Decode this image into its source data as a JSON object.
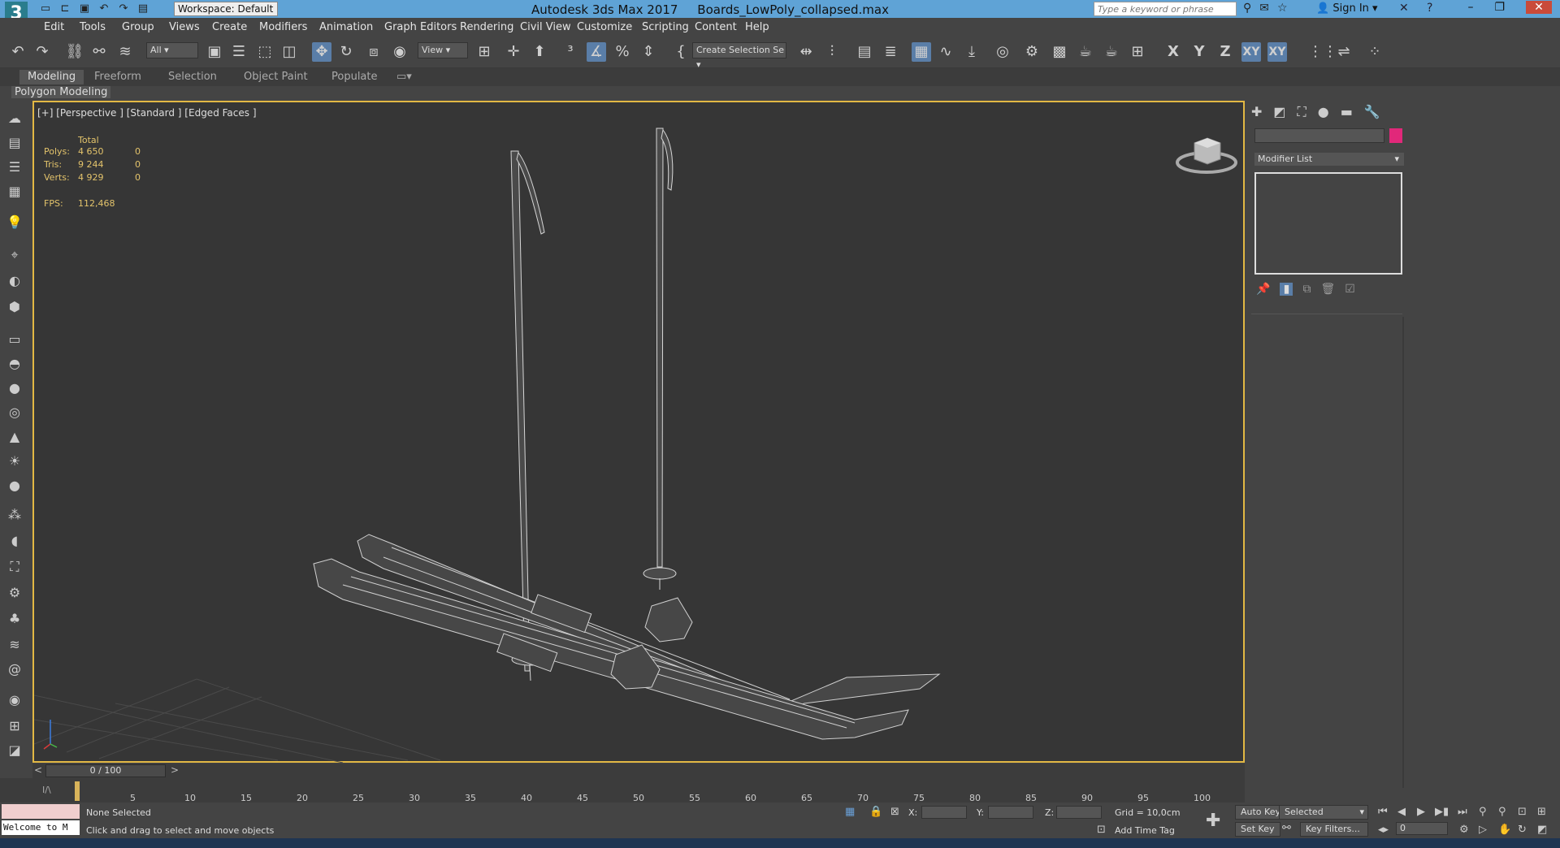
{
  "titlebar": {
    "workspace": "Workspace: Default",
    "app_title": "Autodesk 3ds Max 2017",
    "file_name": "Boards_LowPoly_collapsed.max",
    "search_placeholder": "Type a keyword or phrase",
    "sign_in": "Sign In"
  },
  "menu": [
    "Edit",
    "Tools",
    "Group",
    "Views",
    "Create",
    "Modifiers",
    "Animation",
    "Graph Editors",
    "Rendering",
    "Civil View",
    "Customize",
    "Scripting",
    "Content",
    "Help"
  ],
  "toolbar": {
    "selection_filter": "All",
    "ref_coord": "View",
    "selection_set": "Create Selection Se",
    "axis_x": "X",
    "axis_y": "Y",
    "axis_z": "Z",
    "axis_xy": "XY",
    "axis_xy2": "XY"
  },
  "ribbon": {
    "tabs": [
      "Modeling",
      "Freeform",
      "Selection",
      "Object Paint",
      "Populate"
    ],
    "panel_label": "Polygon Modeling"
  },
  "viewport": {
    "label": "[+] [Perspective ] [Standard ] [Edged Faces ]",
    "stats": {
      "total": "Total",
      "polys_label": "Polys:",
      "polys_value": "4 650",
      "polys_sel": "0",
      "tris_label": "Tris:",
      "tris_value": "9 244",
      "tris_sel": "0",
      "verts_label": "Verts:",
      "verts_value": "4 929",
      "verts_sel": "0",
      "fps_label": "FPS:",
      "fps_value": "112,468"
    }
  },
  "command_panel": {
    "modifier_list": "Modifier List",
    "color_swatch": "#e1287a"
  },
  "timeline": {
    "slider": "0 / 100",
    "ticks": [
      "5",
      "10",
      "15",
      "20",
      "25",
      "30",
      "35",
      "40",
      "45",
      "50",
      "55",
      "60",
      "65",
      "70",
      "75",
      "80",
      "85",
      "90",
      "95",
      "100"
    ]
  },
  "status": {
    "maxscript": "Welcome to M",
    "selection": "None Selected",
    "prompt": "Click and drag to select and move objects",
    "x_label": "X:",
    "y_label": "Y:",
    "z_label": "Z:",
    "grid": "Grid = 10,0cm",
    "add_time_tag": "Add Time Tag",
    "auto_key": "Auto Key",
    "set_key": "Set Key",
    "key_mode": "Selected",
    "key_filters": "Key Filters...",
    "frame": "0"
  }
}
